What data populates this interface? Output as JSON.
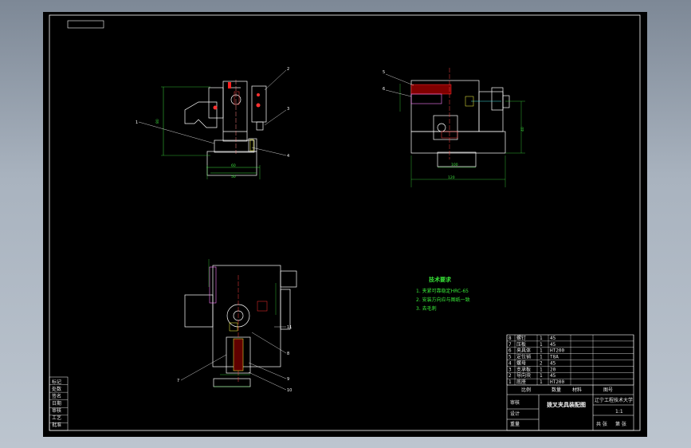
{
  "notes": {
    "title": "技术要求",
    "items": [
      "1. 夹紧可靠稳定HRC-65",
      "2. 安装方向应与图纸一致",
      "3. 去毛刺"
    ]
  },
  "title_block": {
    "drawing_name": "拨叉夹具装配图",
    "school": "辽宁工程技术大学",
    "cells": [
      "比例",
      "数量",
      "材料",
      "图号",
      "审核",
      "设计",
      "重量",
      "共 张",
      "第 张",
      "1:1"
    ]
  },
  "parts_list": [
    {
      "no": "8",
      "name": "螺钉",
      "qty": "1",
      "material": "45"
    },
    {
      "no": "7",
      "name": "压板",
      "qty": "1",
      "material": "45"
    },
    {
      "no": "6",
      "name": "夹具体",
      "qty": "1",
      "material": "HT200"
    },
    {
      "no": "5",
      "name": "定位销",
      "qty": "1",
      "material": "T8A"
    },
    {
      "no": "4",
      "name": "螺母",
      "qty": "2",
      "material": "45"
    },
    {
      "no": "3",
      "name": "支承板",
      "qty": "1",
      "material": "20"
    },
    {
      "no": "2",
      "name": "导向块",
      "qty": "1",
      "material": "45"
    },
    {
      "no": "1",
      "name": "底座",
      "qty": "1",
      "material": "HT200"
    }
  ],
  "side_block": [
    "标记",
    "处数",
    "签名",
    "日期",
    "审核",
    "工艺",
    "批准"
  ],
  "balloons": {
    "top_left": [
      "1",
      "2",
      "3",
      "4"
    ],
    "top_right": [
      "5",
      "6"
    ],
    "bottom": [
      "7",
      "8",
      "9",
      "10",
      "11"
    ]
  },
  "dimensions": {
    "d1": "80",
    "d2": "60",
    "d3": "50",
    "d4": "100",
    "d5": "120",
    "d6": "40"
  },
  "colors": {
    "background": "#000000",
    "outline": "#ffffff",
    "dimension": "#3ee03e",
    "accent_red": "#ff2020",
    "accent_cyan": "#40e0e0",
    "accent_yellow": "#ffff40",
    "accent_pink": "#ff80ff"
  }
}
